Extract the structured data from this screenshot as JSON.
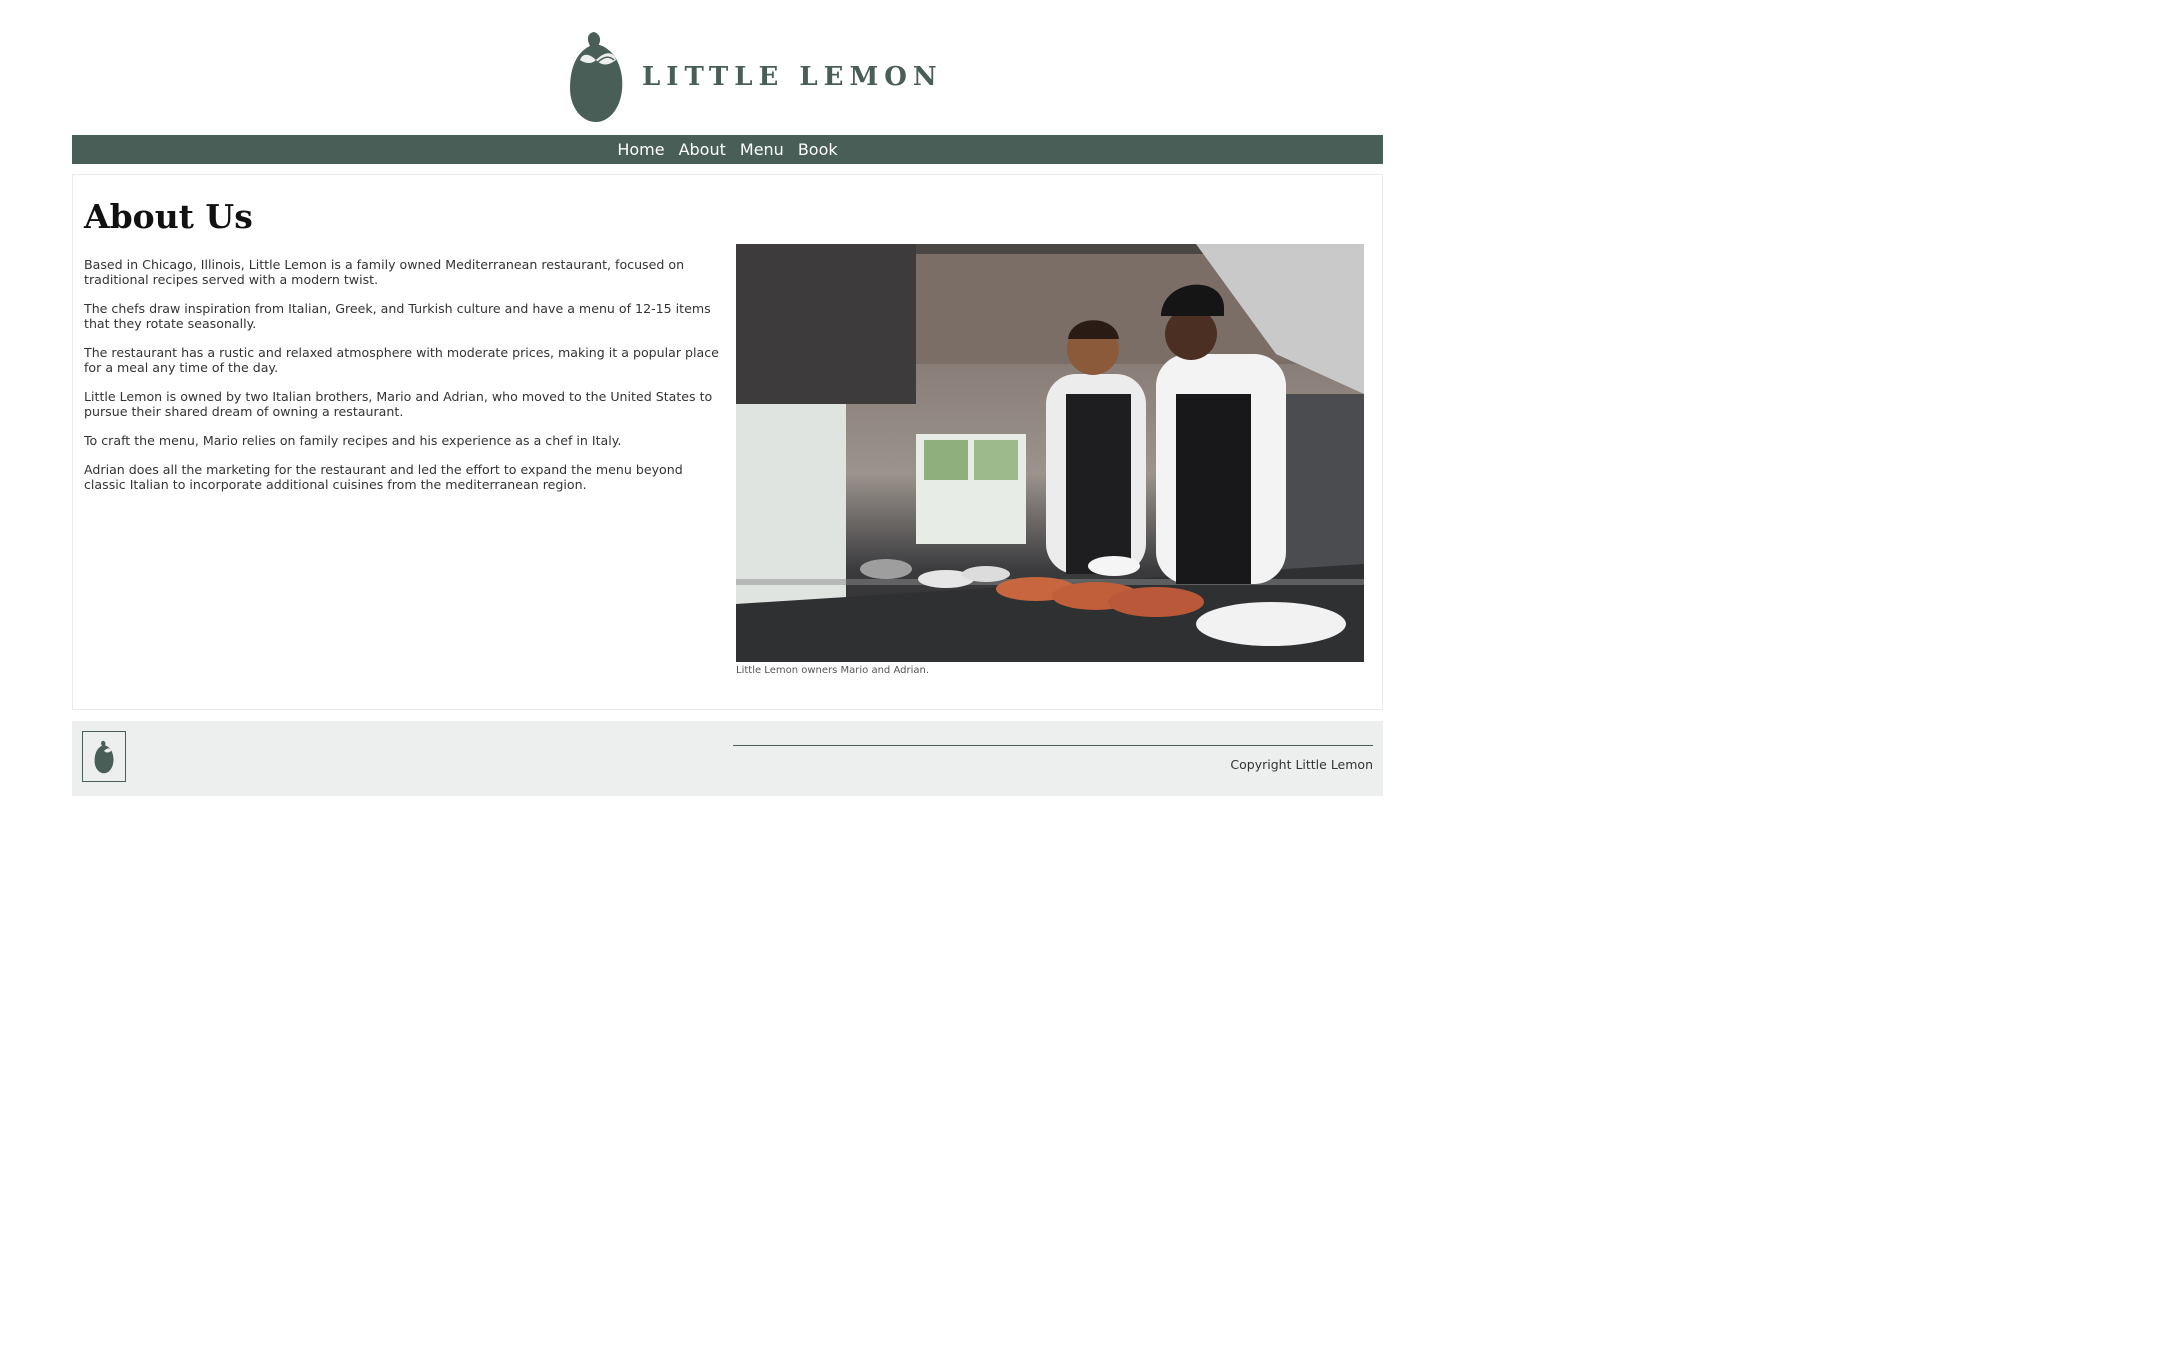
{
  "brand": {
    "name": "LITTLE LEMON",
    "logo_icon": "lemon-icon",
    "color": "#495e57"
  },
  "nav": {
    "items": [
      "Home",
      "About",
      "Menu",
      "Book"
    ],
    "background": "#495e57"
  },
  "main": {
    "title": "About Us",
    "paragraphs": [
      "Based in Chicago, Illinois, Little Lemon is a family owned Mediterranean restaurant, focused on traditional recipes served with a modern twist.",
      "The chefs draw inspiration from Italian, Greek, and Turkish culture and have a menu of 12-15 items that they rotate seasonally.",
      "The restaurant has a rustic and relaxed atmosphere with moderate prices, making it a popular place for a meal any time of the day.",
      "Little Lemon is owned by two Italian brothers, Mario and Adrian, who moved to the United States to pursue their shared dream of owning a restaurant.",
      "To craft the menu, Mario relies on family recipes and his experience as a chef in Italy.",
      "Adrian does all the marketing for the restaurant and led the effort to expand the menu beyond classic Italian to incorporate additional cuisines from the mediterranean region."
    ],
    "figure": {
      "caption": "Little Lemon owners Mario and Adrian."
    }
  },
  "footer": {
    "copyright": "Copyright Little Lemon",
    "logo_icon": "lemon-icon",
    "background": "#edefee"
  }
}
